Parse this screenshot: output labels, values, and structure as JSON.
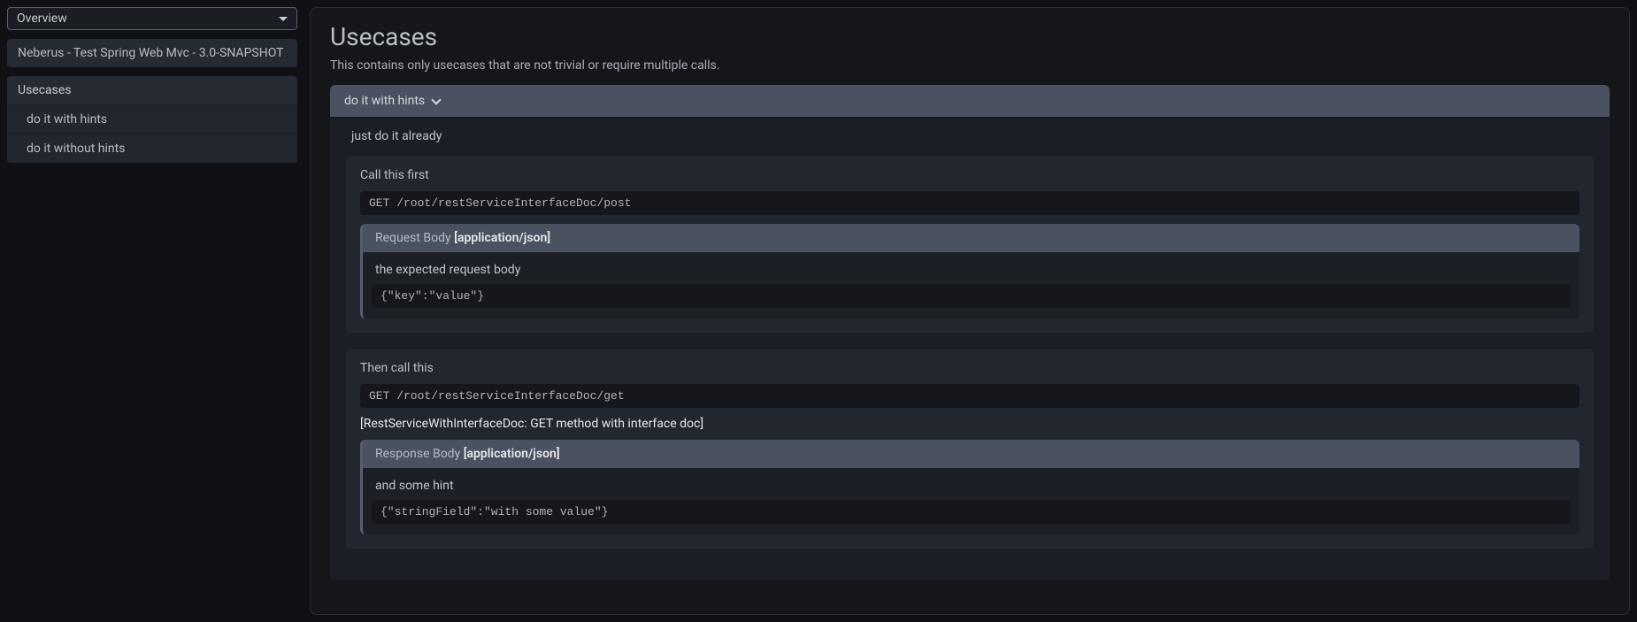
{
  "sidebar": {
    "dropdown_label": "Overview",
    "app_title": "Neberus - Test Spring Web Mvc - 3.0-SNAPSHOT",
    "nav_header": "Usecases",
    "items": [
      {
        "label": "do it with hints"
      },
      {
        "label": "do it without hints"
      }
    ]
  },
  "page": {
    "title": "Usecases",
    "description": "This contains only usecases that are not trivial or require multiple calls."
  },
  "usecase": {
    "header_label": "do it with hints",
    "intro": "just do it already",
    "calls": [
      {
        "title": "Call this first",
        "method": "GET",
        "path": "/root/restServiceInterfaceDoc/post",
        "request_line": "GET /root/restServiceInterfaceDoc/post",
        "doc": "",
        "body": {
          "kind_label": "Request Body",
          "mime": "[application/json]",
          "description": "the expected request body",
          "json": "{\"key\":\"value\"}"
        }
      },
      {
        "title": "Then call this",
        "method": "GET",
        "path": "/root/restServiceInterfaceDoc/get",
        "request_line": "GET /root/restServiceInterfaceDoc/get",
        "doc": "[RestServiceWithInterfaceDoc: GET method with interface doc]",
        "body": {
          "kind_label": "Response Body",
          "mime": "[application/json]",
          "description": "and some hint",
          "json": "{\"stringField\":\"with some value\"}"
        }
      }
    ]
  }
}
